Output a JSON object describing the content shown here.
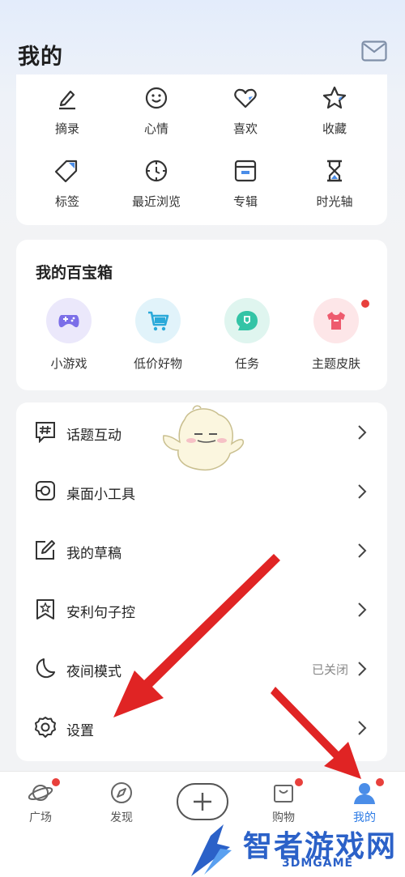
{
  "header": {
    "title": "我的",
    "mail_icon": "mail-icon"
  },
  "top_grid": [
    {
      "label": "摘录",
      "icon": "pen-icon"
    },
    {
      "label": "心情",
      "icon": "smile-icon"
    },
    {
      "label": "喜欢",
      "icon": "heart-icon"
    },
    {
      "label": "收藏",
      "icon": "star-icon"
    },
    {
      "label": "标签",
      "icon": "tag-icon"
    },
    {
      "label": "最近浏览",
      "icon": "clock-icon"
    },
    {
      "label": "专辑",
      "icon": "album-icon"
    },
    {
      "label": "时光轴",
      "icon": "hourglass-icon"
    }
  ],
  "toolbox": {
    "title": "我的百宝箱",
    "items": [
      {
        "label": "小游戏",
        "icon": "gamepad-icon",
        "color": "#7b6ee8",
        "bg": "#ebe8fb"
      },
      {
        "label": "低价好物",
        "icon": "cart-icon",
        "color": "#2aa9d9",
        "bg": "#e1f3fa"
      },
      {
        "label": "任务",
        "icon": "task-bubble-icon",
        "color": "#34c4a6",
        "bg": "#dff5ef"
      },
      {
        "label": "主题皮肤",
        "icon": "shirt-icon",
        "color": "#ee5b6e",
        "bg": "#fde6e8",
        "badge": true
      }
    ]
  },
  "menu": [
    {
      "label": "话题互动",
      "icon": "hashtag-chat-icon"
    },
    {
      "label": "桌面小工具",
      "icon": "widget-icon"
    },
    {
      "label": "我的草稿",
      "icon": "draft-icon"
    },
    {
      "label": "安利句子控",
      "icon": "bookmark-star-icon"
    },
    {
      "label": "夜间模式",
      "icon": "moon-icon",
      "status": "已关闭"
    },
    {
      "label": "设置",
      "icon": "gear-icon"
    }
  ],
  "tabbar": {
    "tabs": [
      {
        "label": "广场",
        "icon": "planet-icon",
        "badge": true
      },
      {
        "label": "发现",
        "icon": "compass-icon",
        "badge": false
      },
      {
        "label": "",
        "icon": "plus-icon",
        "badge": false
      },
      {
        "label": "购物",
        "icon": "bag-icon",
        "badge": true
      },
      {
        "label": "我的",
        "icon": "user-icon",
        "badge": true,
        "active": true
      }
    ]
  },
  "watermark": {
    "main": "智者游戏网",
    "sub": "3DMGAME"
  },
  "colors": {
    "accent": "#2c7be5",
    "badge": "#e8403c",
    "arrow": "#e02424"
  }
}
